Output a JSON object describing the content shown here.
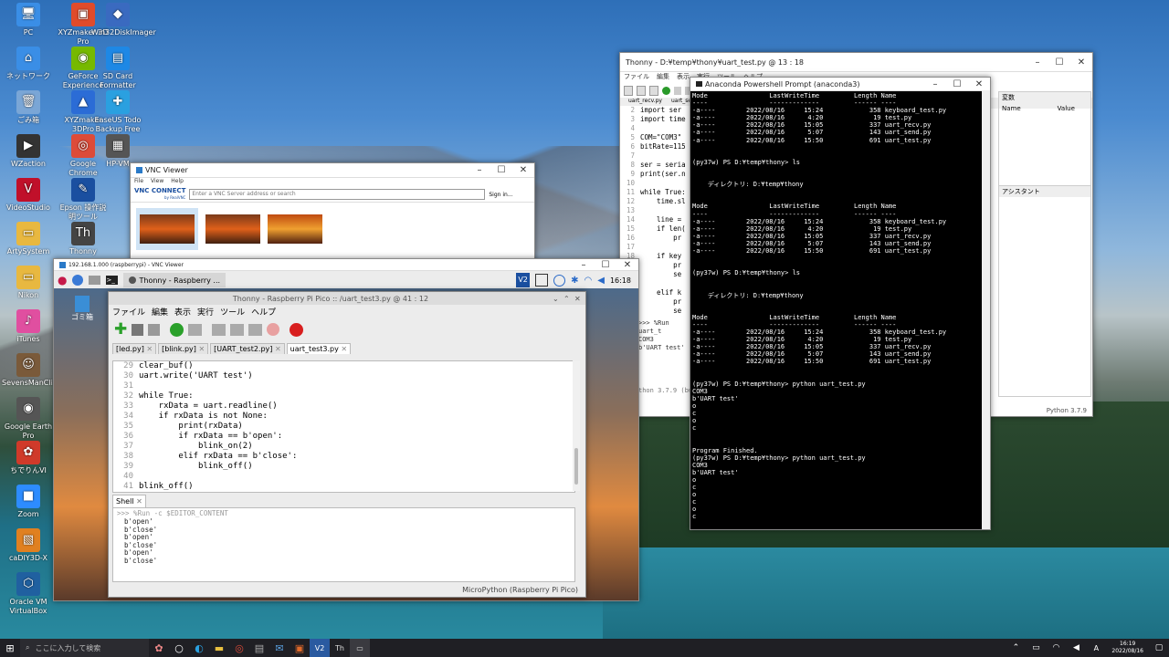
{
  "desktop_icons": [
    {
      "label": "PC",
      "color": "#3a8ee6",
      "glyph": "🖥"
    },
    {
      "label": "XYZmaker 3D Pro",
      "color": "#e04b2b",
      "glyph": "▣"
    },
    {
      "label": "Win32DiskImager",
      "color": "#3a6ac0",
      "glyph": "◆"
    },
    {
      "label": "ネットワーク",
      "color": "#3a8ee6",
      "glyph": "⌂"
    },
    {
      "label": "GeForce Experience",
      "color": "#76b900",
      "glyph": "◉"
    },
    {
      "label": "SD Card Formatter",
      "color": "#1e88e5",
      "glyph": "▤"
    },
    {
      "label": "ごみ箱",
      "color": "#7aa6d6",
      "glyph": "🗑"
    },
    {
      "label": "XYZmaker 3DPro",
      "color": "#2b6cd6",
      "glyph": "▲"
    },
    {
      "label": "EaseUS Todo Backup Free",
      "color": "#2aa0e0",
      "glyph": "✚"
    },
    {
      "label": "WZaction",
      "color": "#333",
      "glyph": "▶"
    },
    {
      "label": "Google Chrome",
      "color": "#dd4b39",
      "glyph": "◎"
    },
    {
      "label": "HP-VM",
      "color": "#555",
      "glyph": "▦"
    },
    {
      "label": "VideoStudio",
      "color": "#c0102a",
      "glyph": "V"
    },
    {
      "label": "Epson 操作説明ツール",
      "color": "#1a4fa0",
      "glyph": "✎"
    },
    {
      "label": "ArtySystem",
      "color": "#e8b840",
      "glyph": "▭"
    },
    {
      "label": "Thonny",
      "color": "#444",
      "glyph": "Th"
    },
    {
      "label": "Nikon",
      "color": "#e8b840",
      "glyph": "▭"
    },
    {
      "label": "iTunes",
      "color": "#e04fa0",
      "glyph": "♪"
    },
    {
      "label": "SevensManClient",
      "color": "#7a5a3a",
      "glyph": "☺"
    },
    {
      "label": "Google Earth Pro",
      "color": "#555",
      "glyph": "◉"
    },
    {
      "label": "ちでりんVI",
      "color": "#d03a2a",
      "glyph": "✿"
    },
    {
      "label": "Zoom",
      "color": "#2d8cff",
      "glyph": "■"
    },
    {
      "label": "caDIY3D-X",
      "color": "#e08020",
      "glyph": "▧"
    },
    {
      "label": "Oracle VM VirtualBox",
      "color": "#2060a0",
      "glyph": "⬡"
    }
  ],
  "thonny_bg": {
    "title": "Thonny - D:¥temp¥thony¥uart_test.py @ 13 : 18",
    "menu": [
      "ファイル",
      "編集",
      "表示",
      "実行",
      "ツール",
      "ヘルプ"
    ],
    "tabs": [
      "uart_recv.py",
      "uart_sen"
    ],
    "code": [
      {
        "n": "2",
        "t": "import ser"
      },
      {
        "n": "3",
        "t": "import time"
      },
      {
        "n": "4",
        "t": ""
      },
      {
        "n": "5",
        "t": "COM=\"COM3\""
      },
      {
        "n": "6",
        "t": "bitRate=115"
      },
      {
        "n": "7",
        "t": ""
      },
      {
        "n": "8",
        "t": "ser = seria"
      },
      {
        "n": "9",
        "t": "print(ser.n"
      },
      {
        "n": "10",
        "t": ""
      },
      {
        "n": "11",
        "t": "while True:"
      },
      {
        "n": "12",
        "t": "    time.sl"
      },
      {
        "n": "13",
        "t": ""
      },
      {
        "n": "14",
        "t": "    line ="
      },
      {
        "n": "15",
        "t": "    if len("
      },
      {
        "n": "16",
        "t": "        pr"
      },
      {
        "n": "17",
        "t": ""
      },
      {
        "n": "18",
        "t": "    if key"
      },
      {
        "n": "19",
        "t": "        pr"
      },
      {
        "n": "20",
        "t": "        se"
      },
      {
        "n": "21",
        "t": ""
      },
      {
        "n": "22",
        "t": "    elif k"
      },
      {
        "n": "23",
        "t": "        pr"
      },
      {
        "n": "24",
        "t": "        se"
      }
    ],
    "shell_lines": [
      ">>> %Run uart_t",
      "COM3",
      "b'UART test'"
    ],
    "shell_status": "thon 3.7.9 (bundled)",
    "vars_title": "変数",
    "vars_cols": [
      "Name",
      "Value"
    ],
    "assist_title": "アシスタント",
    "status": "Python 3.7.9"
  },
  "powershell": {
    "title": "Anaconda Powershell Prompt (anaconda3)",
    "lines": [
      "Mode                LastWriteTime         Length Name",
      "----                -------------         ------ ----",
      "-a----        2022/08/16     15:24            358 keyboard_test.py",
      "-a----        2022/08/16      4:20             19 test.py",
      "-a----        2022/08/16     15:05            337 uart_recv.py",
      "-a----        2022/08/16      5:07            143 uart_send.py",
      "-a----        2022/08/16     15:50            691 uart_test.py",
      "",
      "",
      "(py37w) PS D:¥temp¥thony> ls",
      "",
      "",
      "    ディレクトリ: D:¥temp¥thony",
      "",
      "",
      "Mode                LastWriteTime         Length Name",
      "----                -------------         ------ ----",
      "-a----        2022/08/16     15:24            358 keyboard_test.py",
      "-a----        2022/08/16      4:20             19 test.py",
      "-a----        2022/08/16     15:05            337 uart_recv.py",
      "-a----        2022/08/16      5:07            143 uart_send.py",
      "-a----        2022/08/16     15:50            691 uart_test.py",
      "",
      "",
      "(py37w) PS D:¥temp¥thony> ls",
      "",
      "",
      "    ディレクトリ: D:¥temp¥thony",
      "",
      "",
      "Mode                LastWriteTime         Length Name",
      "----                -------------         ------ ----",
      "-a----        2022/08/16     15:24            358 keyboard_test.py",
      "-a----        2022/08/16      4:20             19 test.py",
      "-a----        2022/08/16     15:05            337 uart_recv.py",
      "-a----        2022/08/16      5:07            143 uart_send.py",
      "-a----        2022/08/16     15:50            691 uart_test.py",
      "",
      "",
      "(py37w) PS D:¥temp¥thony> python uart_test.py",
      "COM3",
      "b'UART test'",
      "o",
      "c",
      "o",
      "c",
      "",
      "",
      "Program Finished.",
      "(py37w) PS D:¥temp¥thony> python uart_test.py",
      "COM3",
      "b'UART test'",
      "o",
      "c",
      "o",
      "c",
      "o",
      "c",
      "",
      "",
      "Program Finished.",
      "(py37w) PS D:¥temp¥thony> "
    ]
  },
  "vnc_viewer": {
    "title": "VNC Viewer",
    "menu": [
      "File",
      "View",
      "Help"
    ],
    "brand": "VNC CONNECT",
    "brand_sub": "by RealVNC",
    "search_placeholder": "Enter a VNC Server address or search",
    "signin": "Sign in..."
  },
  "vnc_session": {
    "title": "192.168.1.000 (raspberrypi) - VNC Viewer",
    "pi_taskbar_app": "Thonny - Raspberry ...",
    "pi_clock": "16:18",
    "trash_label": "ゴミ箱"
  },
  "thonny_pi": {
    "title": "Thonny  -  Raspberry Pi Pico :: /uart_test3.py  @  41 : 12",
    "menu": [
      "ファイル",
      "編集",
      "表示",
      "実行",
      "ツール",
      "ヘルプ"
    ],
    "tabs": [
      "[led.py]",
      "[blink.py]",
      "[UART_test2.py]",
      "uart_test3.py"
    ],
    "code": [
      {
        "n": "29",
        "t": "clear_buf()"
      },
      {
        "n": "30",
        "t": "uart.write('UART test')"
      },
      {
        "n": "31",
        "t": ""
      },
      {
        "n": "32",
        "t": "while True:"
      },
      {
        "n": "33",
        "t": "    rxData = uart.readline()"
      },
      {
        "n": "34",
        "t": "    if rxData is not None:"
      },
      {
        "n": "35",
        "t": "        print(rxData)"
      },
      {
        "n": "36",
        "t": "        if rxData == b'open':"
      },
      {
        "n": "37",
        "t": "            blink_on(2)"
      },
      {
        "n": "38",
        "t": "        elif rxData == b'close':"
      },
      {
        "n": "39",
        "t": "            blink_off()"
      },
      {
        "n": "40",
        "t": ""
      },
      {
        "n": "41",
        "t": "blink_off()"
      }
    ],
    "shell_tab": "Shell",
    "shell_cmd": ">>> %Run -c $EDITOR_CONTENT",
    "shell_lines": [
      "b'open'",
      "b'close'",
      "b'open'",
      "b'close'",
      "b'open'",
      "b'close'"
    ],
    "status": "MicroPython (Raspberry Pi Pico)"
  },
  "taskbar": {
    "search_placeholder": "ここに入力して検索",
    "time": "16:19",
    "date": "2022/08/16",
    "ime": "A"
  }
}
